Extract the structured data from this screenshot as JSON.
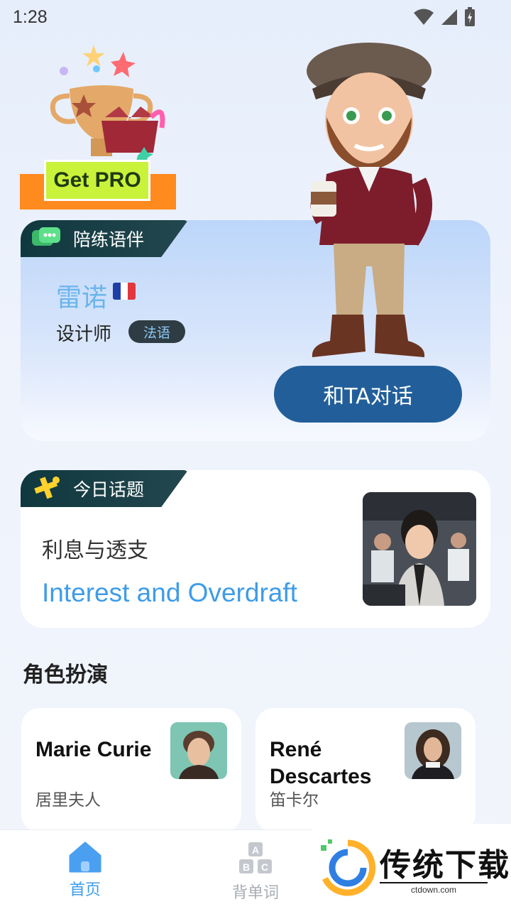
{
  "status_bar": {
    "time": "1:28"
  },
  "promo": {
    "label": "Get PRO"
  },
  "partner": {
    "section_label": "陪练语伴",
    "name": "雷诺",
    "role": "设计师",
    "language": "法语",
    "talk_button": "和TA对话"
  },
  "topic": {
    "section_label": "今日话题",
    "title_zh": "利息与透支",
    "title_en": "Interest and Overdraft"
  },
  "roleplay": {
    "title": "角色扮演",
    "cards": [
      {
        "name": "Marie Curie",
        "name_zh": "居里夫人"
      },
      {
        "name": "René Descartes",
        "name_zh": "笛卡尔"
      }
    ]
  },
  "nav": {
    "items": [
      {
        "label": "首页",
        "icon": "home-icon",
        "active": true
      },
      {
        "label": "背单词",
        "icon": "abc-blocks-icon",
        "active": false
      }
    ]
  },
  "watermark": {
    "text": "传统下载",
    "sub": "ctdown.com"
  },
  "colors": {
    "accent": "#225f9a",
    "active_nav": "#3e9ce8",
    "inactive_nav": "#a8adb5"
  }
}
